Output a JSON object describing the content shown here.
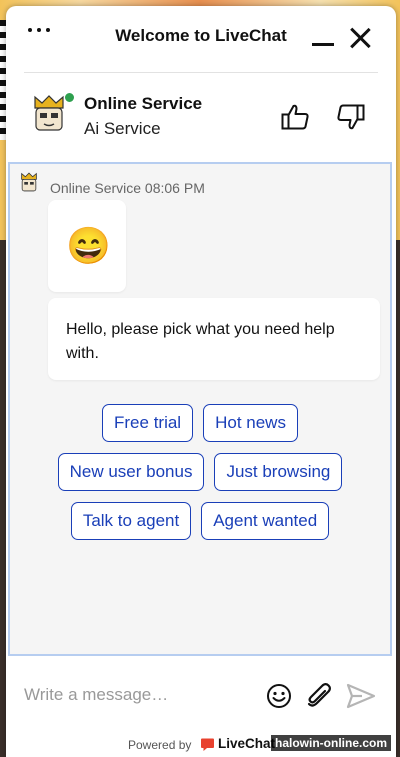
{
  "header": {
    "title": "Welcome to LiveChat"
  },
  "agent": {
    "name": "Online Service",
    "role": "Ai Service",
    "status_color": "#2ea04f"
  },
  "chat": {
    "meta": "Online Service 08:06 PM",
    "emoji": "😄",
    "message": "Hello, please pick what you need help with.",
    "quick_replies": [
      "Free trial",
      "Hot news",
      "New user bonus",
      "Just browsing",
      "Talk to agent",
      "Agent wanted"
    ]
  },
  "composer": {
    "placeholder": "Write a message…"
  },
  "footer": {
    "powered_by": "Powered by",
    "brand": "LiveChat",
    "brand_color": "#e8412e"
  },
  "watermark": "halowin-online.com",
  "colors": {
    "accent": "#1a3fb8",
    "chat_border": "#b6cdf0"
  }
}
